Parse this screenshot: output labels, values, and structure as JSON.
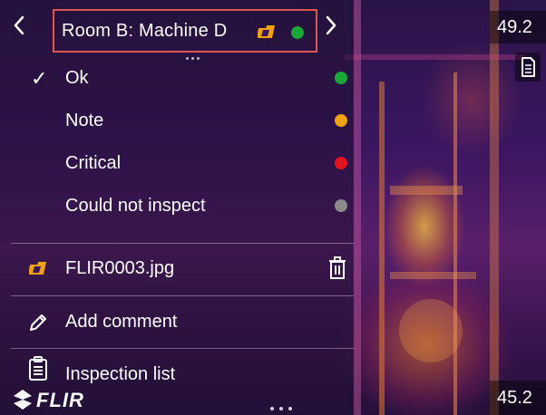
{
  "header": {
    "title": "Room B: Machine D",
    "status_color": "#1aa83a"
  },
  "status_options": [
    {
      "label": "Ok",
      "color": "#1aa83a",
      "selected": true,
      "check": "✓"
    },
    {
      "label": "Note",
      "color": "#f2a20c",
      "selected": false
    },
    {
      "label": "Critical",
      "color": "#e0141e",
      "selected": false
    },
    {
      "label": "Could not inspect",
      "color": "#8a8a8a",
      "selected": false
    }
  ],
  "file": {
    "name": "FLIR0003.jpg",
    "icon": "thermal-image-icon"
  },
  "actions": {
    "add_comment": "Add comment",
    "inspection_list": "Inspection list"
  },
  "temperatures": {
    "max": "49.2",
    "min": "45.2"
  },
  "branding": {
    "logo_text": "FLIR"
  },
  "colors": {
    "highlight_border": "#e0554f",
    "thermal_orange": "#ff9a1a",
    "thermal_purple": "#3a1660"
  }
}
